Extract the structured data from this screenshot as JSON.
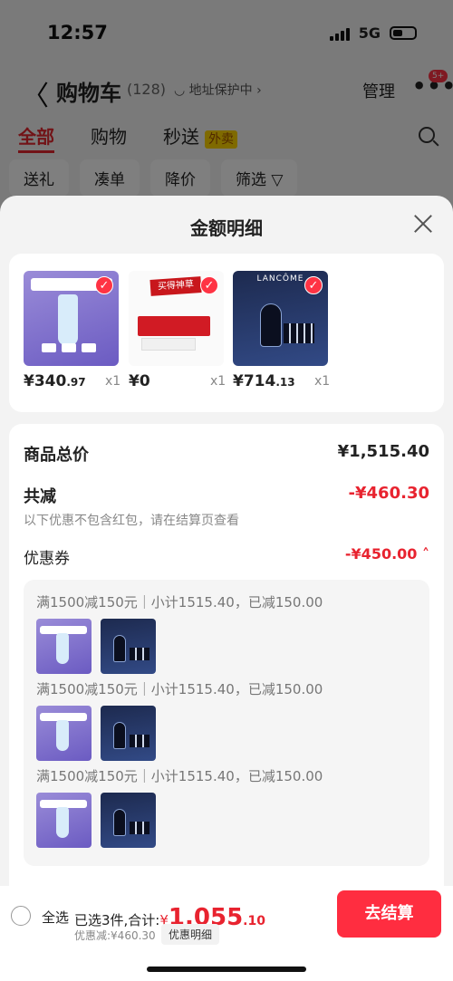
{
  "status": {
    "time": "12:57",
    "network": "5G"
  },
  "nav": {
    "back": "〈",
    "title": "购物车",
    "count": "(128)",
    "address": "◡ 地址保护中 ›",
    "manage": "管理",
    "more": "•••",
    "badge": "5+"
  },
  "tabs": [
    {
      "label": "全部"
    },
    {
      "label": "购物"
    },
    {
      "label": "秒送"
    }
  ],
  "tab_tag": "外卖",
  "filters": [
    "送礼",
    "凑单",
    "降价",
    "筛选 ▽"
  ],
  "sheet": {
    "title": "金额明细"
  },
  "products": [
    {
      "price_int": "¥340",
      "price_dec": ".97",
      "qty": "x1"
    },
    {
      "price_int": "¥0",
      "price_dec": "",
      "qty": "x1"
    },
    {
      "price_int": "¥714",
      "price_dec": ".13",
      "qty": "x1"
    }
  ],
  "summary": {
    "total_label": "商品总价",
    "total_value": "¥1,515.40",
    "reduce_label": "共减",
    "reduce_value": "-¥460.30",
    "reduce_note": "以下优惠不包含红包，请在结算页查看",
    "coupon_label": "优惠券",
    "coupon_value": "-¥450.00 ˄"
  },
  "coupon_groups": [
    {
      "text": "满1500减150元｜小计1515.40，已减150.00"
    },
    {
      "text": "满1500减150元｜小计1515.40，已减150.00"
    },
    {
      "text": "满1500减150元｜小计1515.40，已减150.00"
    }
  ],
  "product_images": {
    "p2_stamp": "买得神草",
    "p3_brand": "LANCÔME"
  },
  "bottom": {
    "select_all": "全选",
    "picked": "已选3件,合计:",
    "yen": "¥",
    "total_int": "1,055",
    "total_dec": ".10",
    "discount": "优惠减:¥460.30",
    "detail": "优惠明细",
    "checkout": "去结算"
  },
  "colors": {
    "accent": "#e8232f",
    "checkout_bg": "#ff2d40"
  }
}
